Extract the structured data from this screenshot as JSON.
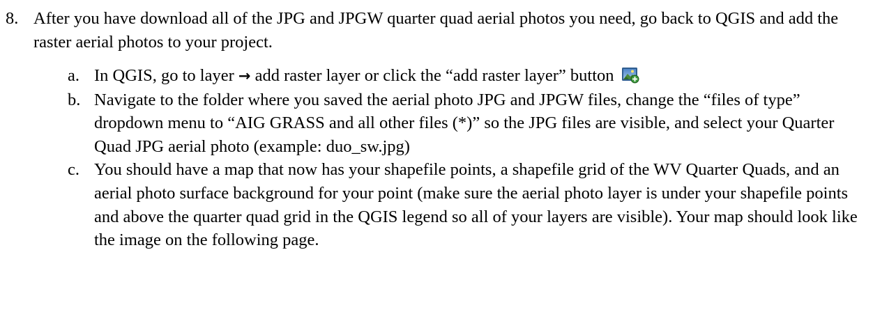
{
  "step": {
    "number": "8.",
    "text": "After you have download all of the JPG and JPGW quarter quad aerial photos you need, go back to QGIS and add the raster aerial photos to your project."
  },
  "substeps": [
    {
      "label": "a.",
      "text_before": "In QGIS, go to layer",
      "arrow": "→",
      "text_after": "add raster layer or click the “add raster layer” button",
      "icon": "add-raster-layer-icon"
    },
    {
      "label": "b.",
      "text": "Navigate to the folder where you saved the aerial photo JPG and JPGW files, change the “files of type” dropdown menu to “AIG GRASS and all other files (*)” so the JPG files are visible, and select your Quarter Quad JPG aerial photo (example: duo_sw.jpg)"
    },
    {
      "label": "c.",
      "text": "You should have a map that now has your shapefile points, a shapefile grid of the WV Quarter Quads, and an aerial photo surface background for your point (make sure the aerial photo layer is under your shapefile points and above the quarter quad grid in the QGIS legend so all of your layers are visible).  Your map should look like the image on the following page."
    }
  ]
}
